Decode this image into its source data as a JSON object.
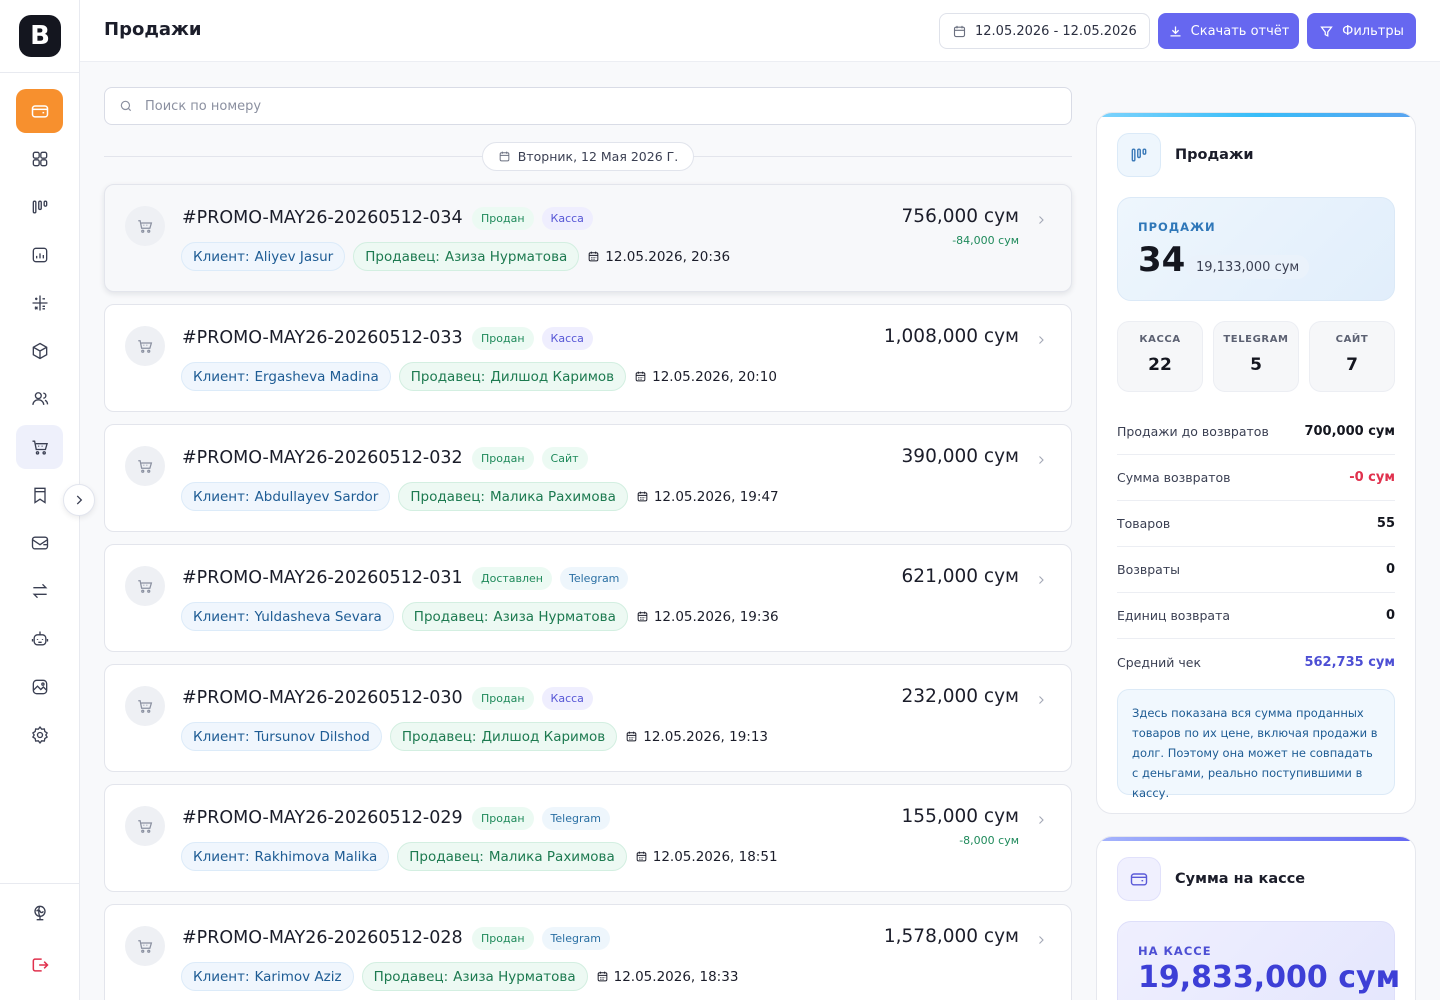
{
  "app": {
    "logo_letter": "B",
    "page_title": "Продажи"
  },
  "header": {
    "date_range": "12.05.2026 - 12.05.2026",
    "download_label": "Скачать отчёт",
    "filters_label": "Фильтры"
  },
  "search": {
    "placeholder": "Поиск по номеру"
  },
  "day": {
    "label": "Вторник, 12 Мая 2026 Г."
  },
  "labels": {
    "client": "Клиент:",
    "seller": "Продавец:"
  },
  "orders": [
    {
      "id": "#PROMO-MAY26-20260512-034",
      "status": "Продан",
      "channel": "Касса",
      "client": "Aliyev Jasur",
      "seller": "Азиза Нурматова",
      "datetime": "12.05.2026, 20:36",
      "amount": "756,000 сум",
      "discount": "-84,000 сум"
    },
    {
      "id": "#PROMO-MAY26-20260512-033",
      "status": "Продан",
      "channel": "Касса",
      "client": "Ergasheva Madina",
      "seller": "Дилшод Каримов",
      "datetime": "12.05.2026, 20:10",
      "amount": "1,008,000 сум",
      "discount": ""
    },
    {
      "id": "#PROMO-MAY26-20260512-032",
      "status": "Продан",
      "channel": "Сайт",
      "client": "Abdullayev Sardor",
      "seller": "Малика Рахимова",
      "datetime": "12.05.2026, 19:47",
      "amount": "390,000 сум",
      "discount": ""
    },
    {
      "id": "#PROMO-MAY26-20260512-031",
      "status": "Доставлен",
      "channel": "Telegram",
      "client": "Yuldasheva Sevara",
      "seller": "Азиза Нурматова",
      "datetime": "12.05.2026, 19:36",
      "amount": "621,000 сум",
      "discount": ""
    },
    {
      "id": "#PROMO-MAY26-20260512-030",
      "status": "Продан",
      "channel": "Касса",
      "client": "Tursunov Dilshod",
      "seller": "Дилшод Каримов",
      "datetime": "12.05.2026, 19:13",
      "amount": "232,000 сум",
      "discount": ""
    },
    {
      "id": "#PROMO-MAY26-20260512-029",
      "status": "Продан",
      "channel": "Telegram",
      "client": "Rakhimova Malika",
      "seller": "Малика Рахимова",
      "datetime": "12.05.2026, 18:51",
      "amount": "155,000 сум",
      "discount": "-8,000 сум"
    },
    {
      "id": "#PROMO-MAY26-20260512-028",
      "status": "Продан",
      "channel": "Telegram",
      "client": "Karimov Aziz",
      "seller": "Азиза Нурматова",
      "datetime": "12.05.2026, 18:33",
      "amount": "1,578,000 сум",
      "discount": ""
    }
  ],
  "sales_panel": {
    "title": "Продажи",
    "hero_label": "ПРОДАЖИ",
    "hero_count": "34",
    "hero_sum": "19,133,000 сум",
    "channels": [
      {
        "label": "КАССА",
        "value": "22"
      },
      {
        "label": "TELEGRAM",
        "value": "5"
      },
      {
        "label": "САЙТ",
        "value": "7"
      }
    ],
    "stats": [
      {
        "label": "Продажи до возвратов",
        "value": "700,000 сум",
        "tone": "normal"
      },
      {
        "label": "Сумма возвратов",
        "value": "-0 сум",
        "tone": "red"
      },
      {
        "label": "Товаров",
        "value": "55",
        "tone": "normal"
      },
      {
        "label": "Возвраты",
        "value": "0",
        "tone": "normal"
      },
      {
        "label": "Единиц возврата",
        "value": "0",
        "tone": "normal"
      },
      {
        "label": "Средний чек",
        "value": "562,735 сум",
        "tone": "blue"
      }
    ],
    "note": "Здесь показана вся сумма проданных товаров по их цене, включая продажи в долг. Поэтому она может не совпадать с деньгами, реально поступившими в кассу."
  },
  "cash_panel": {
    "title": "Сумма на кассе",
    "hero_label": "НА КАССЕ",
    "hero_value": "19,833,000 сум"
  },
  "nav_icons": [
    "wallet-icon",
    "grid-icon",
    "chart-bars-icon",
    "report-icon",
    "calculator-icon",
    "box-icon",
    "users-icon",
    "cart-icon",
    "bookmark-icon",
    "mail-icon",
    "transfer-icon",
    "bot-icon",
    "image-icon",
    "settings-icon",
    "globe-icon",
    "logout-icon"
  ],
  "colors": {
    "accent": "#6667f0",
    "active_nav": "#f7902e",
    "success": "#1f8a5b",
    "danger": "#e0314d"
  }
}
